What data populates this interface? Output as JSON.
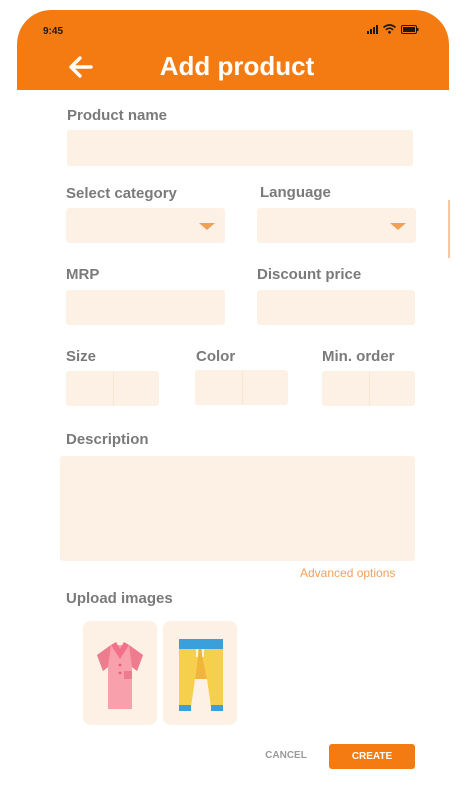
{
  "status_bar": {
    "time": "9:45"
  },
  "header": {
    "title": "Add product",
    "back_icon": "arrow-left-icon"
  },
  "form": {
    "product_name": {
      "label": "Product name",
      "value": ""
    },
    "category": {
      "label": "Select category",
      "value": ""
    },
    "language": {
      "label": "Language",
      "value": ""
    },
    "mrp": {
      "label": "MRP",
      "value": ""
    },
    "discount_price": {
      "label": "Discount price",
      "value": ""
    },
    "size": {
      "label": "Size"
    },
    "color": {
      "label": "Color"
    },
    "min_order": {
      "label": "Min. order"
    },
    "description": {
      "label": "Description",
      "value": ""
    },
    "advanced_link": "Advanced options",
    "upload": {
      "label": "Upload images",
      "images": [
        "shirt-image",
        "pants-image"
      ]
    }
  },
  "actions": {
    "cancel": "CANCEL",
    "create": "CREATE"
  },
  "colors": {
    "accent": "#f37b12",
    "field_bg": "#fdf1e6",
    "label": "#7a7a7a"
  }
}
